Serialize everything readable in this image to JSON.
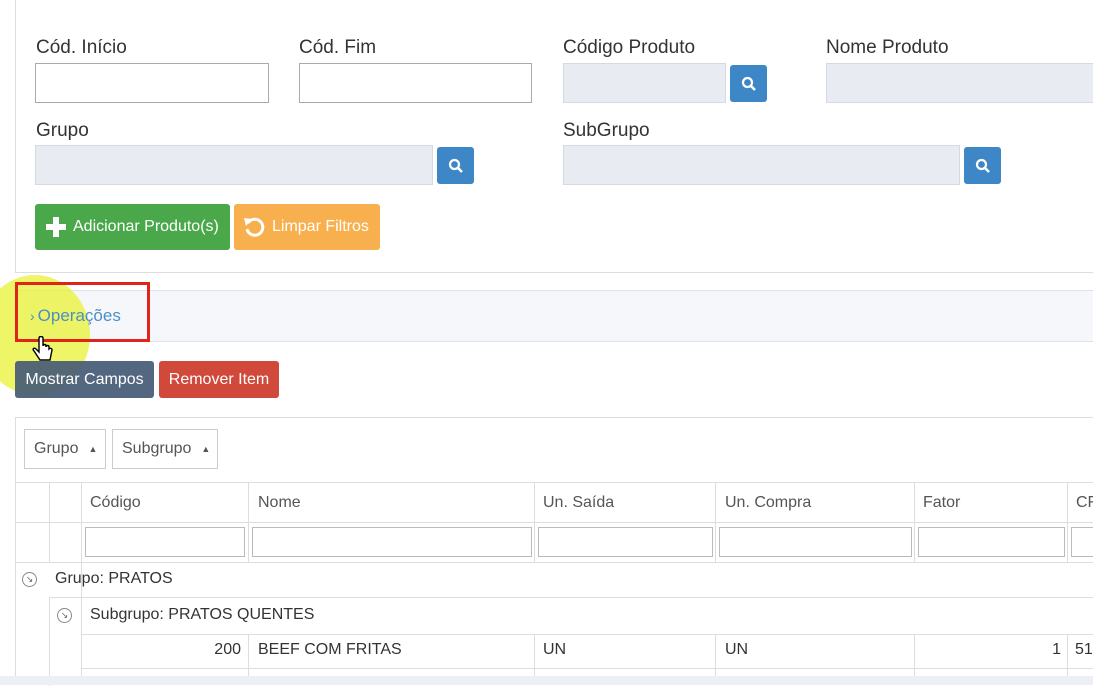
{
  "filters": {
    "cod_inicio_label": "Cód. Início",
    "cod_fim_label": "Cód. Fim",
    "codigo_produto_label": "Código Produto",
    "nome_produto_label": "Nome Produto",
    "grupo_label": "Grupo",
    "subgrupo_label": "SubGrupo"
  },
  "actions": {
    "adicionar_label": "Adicionar Produto(s)",
    "limpar_label": "Limpar Filtros"
  },
  "operacoes": {
    "label": "Operações"
  },
  "toolbar": {
    "mostrar_label": "Mostrar Campos",
    "remover_label": "Remover Item"
  },
  "grouping": {
    "chips": [
      "Grupo",
      "Subgrupo"
    ]
  },
  "table": {
    "columns": [
      "Código",
      "Nome",
      "Un. Saída",
      "Un. Compra",
      "Fator",
      "CF"
    ],
    "group_row": "Grupo: PRATOS",
    "subgroup_row": "Subgrupo: PRATOS QUENTES",
    "rows": [
      {
        "codigo": "200",
        "nome": "BEEF COM FRITAS",
        "un_saida": "UN",
        "un_compra": "UN",
        "fator": "1",
        "cf": "51"
      }
    ]
  },
  "colors": {
    "primary": "#3d87c6",
    "success": "#4aa84a",
    "warning": "#f7b04d",
    "danger": "#d0493b",
    "dark": "#455a75",
    "highlight": "#e8f233",
    "annotation": "#e0241c"
  }
}
